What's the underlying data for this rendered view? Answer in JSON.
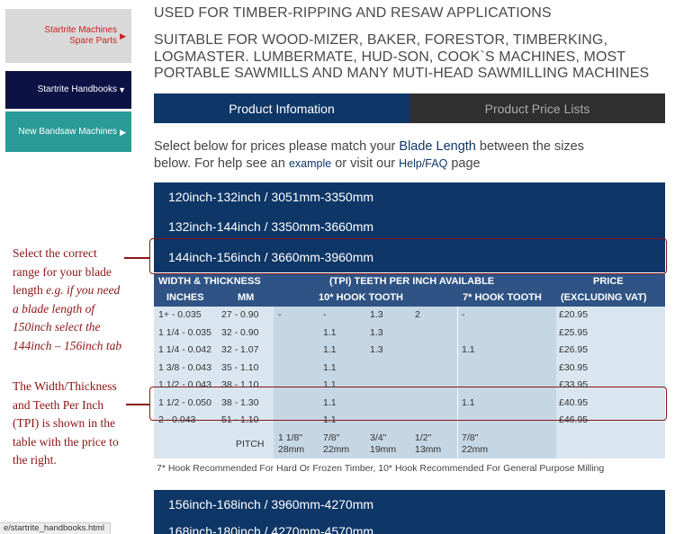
{
  "sidebar": {
    "spare": {
      "line1": "Startrite Machines",
      "line2": "Spare Parts",
      "arrow": "▶"
    },
    "handbooks": {
      "label": "Startrite Handbooks",
      "arrow": "▼"
    },
    "bandsaw": {
      "label": "New Bandsaw Machines",
      "arrow": "▶"
    }
  },
  "header": {
    "line1": "USED FOR TIMBER-RIPPING AND RESAW APPLICATIONS",
    "line2a": "SUITABLE FOR WOOD-MIZER, BAKER, FORESTOR, TIMBERKING,",
    "line2b": "LOGMASTER. LUMBERMATE, HUD-SON, COOK`S MACHINES, MOST",
    "line2c": "PORTABLE SAWMILLS AND MANY MUTI-HEAD SAWMILLING MACHINES"
  },
  "tabs": {
    "info": "Product Infomation",
    "prices": "Product Price Lists"
  },
  "intro": {
    "t1": "Select below for prices please match your ",
    "blade_length": "Blade Length",
    "t2": " between the sizes",
    "t3": "below. For help see an ",
    "example": "example",
    "t4": " or visit our ",
    "help": "Help/FAQ",
    "t5": " page"
  },
  "ranges": [
    "120inch-132inch / 3051mm-3350mm",
    "132inch-144inch / 3350mm-3660mm",
    "144inch-156inch / 3660mm-3960mm"
  ],
  "ranges_after": [
    "156inch-168inch / 3960mm-4270mm",
    "168inch-180inch / 4270mm-4570mm"
  ],
  "table": {
    "head1": {
      "wt": "WIDTH & THICKNESS",
      "tpi": "(TPI) TEETH PER INCH AVAILABLE",
      "price": "PRICE"
    },
    "head2": {
      "inches": "INCHES",
      "mm": "MM",
      "hook10": "10* HOOK TOOTH",
      "hook7": "7* HOOK TOOTH",
      "vat": "(EXCLUDING VAT)"
    },
    "rows": [
      {
        "in": "1+ - 0.035",
        "mm": "27 - 0.90",
        "d1": "-",
        "d2": "-",
        "d3": "1.3",
        "d4": "2",
        "d5": "-",
        "price": "£20.95"
      },
      {
        "in": "1 1/4 - 0.035",
        "mm": "32 - 0.90",
        "d1": "",
        "d2": "1.1",
        "d3": "1.3",
        "d4": "",
        "d5": "",
        "price": "£25.95"
      },
      {
        "in": "1 1/4 - 0.042",
        "mm": "32 - 1.07",
        "d1": "",
        "d2": "1.1",
        "d3": "1.3",
        "d4": "",
        "d5": "1.1",
        "price": "£26.95"
      },
      {
        "in": "1 3/8 - 0.043",
        "mm": "35 - 1.10",
        "d1": "",
        "d2": "1.1",
        "d3": "",
        "d4": "",
        "d5": "",
        "price": "£30.95"
      },
      {
        "in": "1 1/2 - 0.043",
        "mm": "38 - 1.10",
        "d1": "",
        "d2": "1.1",
        "d3": "",
        "d4": "",
        "d5": "",
        "price": "£33.95"
      },
      {
        "in": "1 1/2 - 0.050",
        "mm": "38 - 1.30",
        "d1": "",
        "d2": "1.1",
        "d3": "",
        "d4": "",
        "d5": "1.1",
        "price": "£40.95"
      },
      {
        "in": "2 - 0.043",
        "mm": "51 - 1.10",
        "d1": "",
        "d2": "1.1",
        "d3": "",
        "d4": "",
        "d5": "",
        "price": "£46.95"
      }
    ],
    "pitch": {
      "label": "PITCH",
      "cols": [
        {
          "a": "1 1/8\"",
          "b": "28mm"
        },
        {
          "a": "7/8\"",
          "b": "22mm"
        },
        {
          "a": "3/4\"",
          "b": "19mm"
        },
        {
          "a": "1/2\"",
          "b": "13mm"
        },
        {
          "a": "7/8\"",
          "b": "22mm"
        }
      ]
    }
  },
  "note": "7* Hook Recommended For Hard Or Frozen Timber, 10* Hook Recommended For General Purpose Milling",
  "status_url": "e/startrite_handbooks.html",
  "annotations": {
    "a1_line1": "Select the correct",
    "a1_line2": "range for your blade",
    "a1_line3a": "length ",
    "a1_line3b": "e.g. if you need",
    "a1_line4": "a blade length of",
    "a1_line5a": "150inch",
    "a1_line5b": " select the",
    "a1_line6a": "144inch – 156inch",
    "a1_line6b": " tab",
    "a2_line1": "The Width/Thickness",
    "a2_line2": "and Teeth Per Inch",
    "a2_line3": "(TPI) is shown in the",
    "a2_line4": "table with the price to",
    "a2_line5": "the right."
  },
  "colors": {
    "navy": "#0e3667",
    "dark": "#2f2f2f",
    "teal": "#2a9b97",
    "annotation": "#8b1414"
  }
}
